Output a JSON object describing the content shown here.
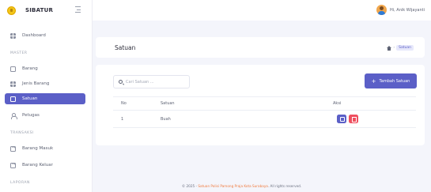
{
  "brand": {
    "name": "SIBATUR"
  },
  "topbar": {
    "user_name": "Hi, Anik Wijayanti"
  },
  "sidebar": {
    "dashboard": "Dashboard",
    "section_master": "MASTER",
    "barang": "Barang",
    "jenis_barang": "Jenis Barang",
    "satuan": "Satuan",
    "petugas": "Petugas",
    "section_transaksi": "TRANSAKSI",
    "barang_masuk": "Barang Masuk",
    "barang_keluar": "Barang Keluar",
    "section_laporan": "LAPORAN"
  },
  "page": {
    "title": "Satuan",
    "breadcrumb_active": "Satuan"
  },
  "table": {
    "search_placeholder": "Cari Satuan ...",
    "add_button": "Tambah Satuan",
    "headers": {
      "no": "No",
      "satuan": "Satuan",
      "aksi": "Aksi"
    },
    "rows": [
      {
        "no": "1",
        "satuan": "Buah"
      }
    ]
  },
  "footer": {
    "prefix": "© 2025 - ",
    "org": "Satuan Polisi Pamong Praja Kota Surabaya",
    "suffix": ". All rights reserved."
  },
  "colors": {
    "accent": "#5b5fc7",
    "danger": "#ef4f5f",
    "footer_link": "#f07b3f"
  }
}
